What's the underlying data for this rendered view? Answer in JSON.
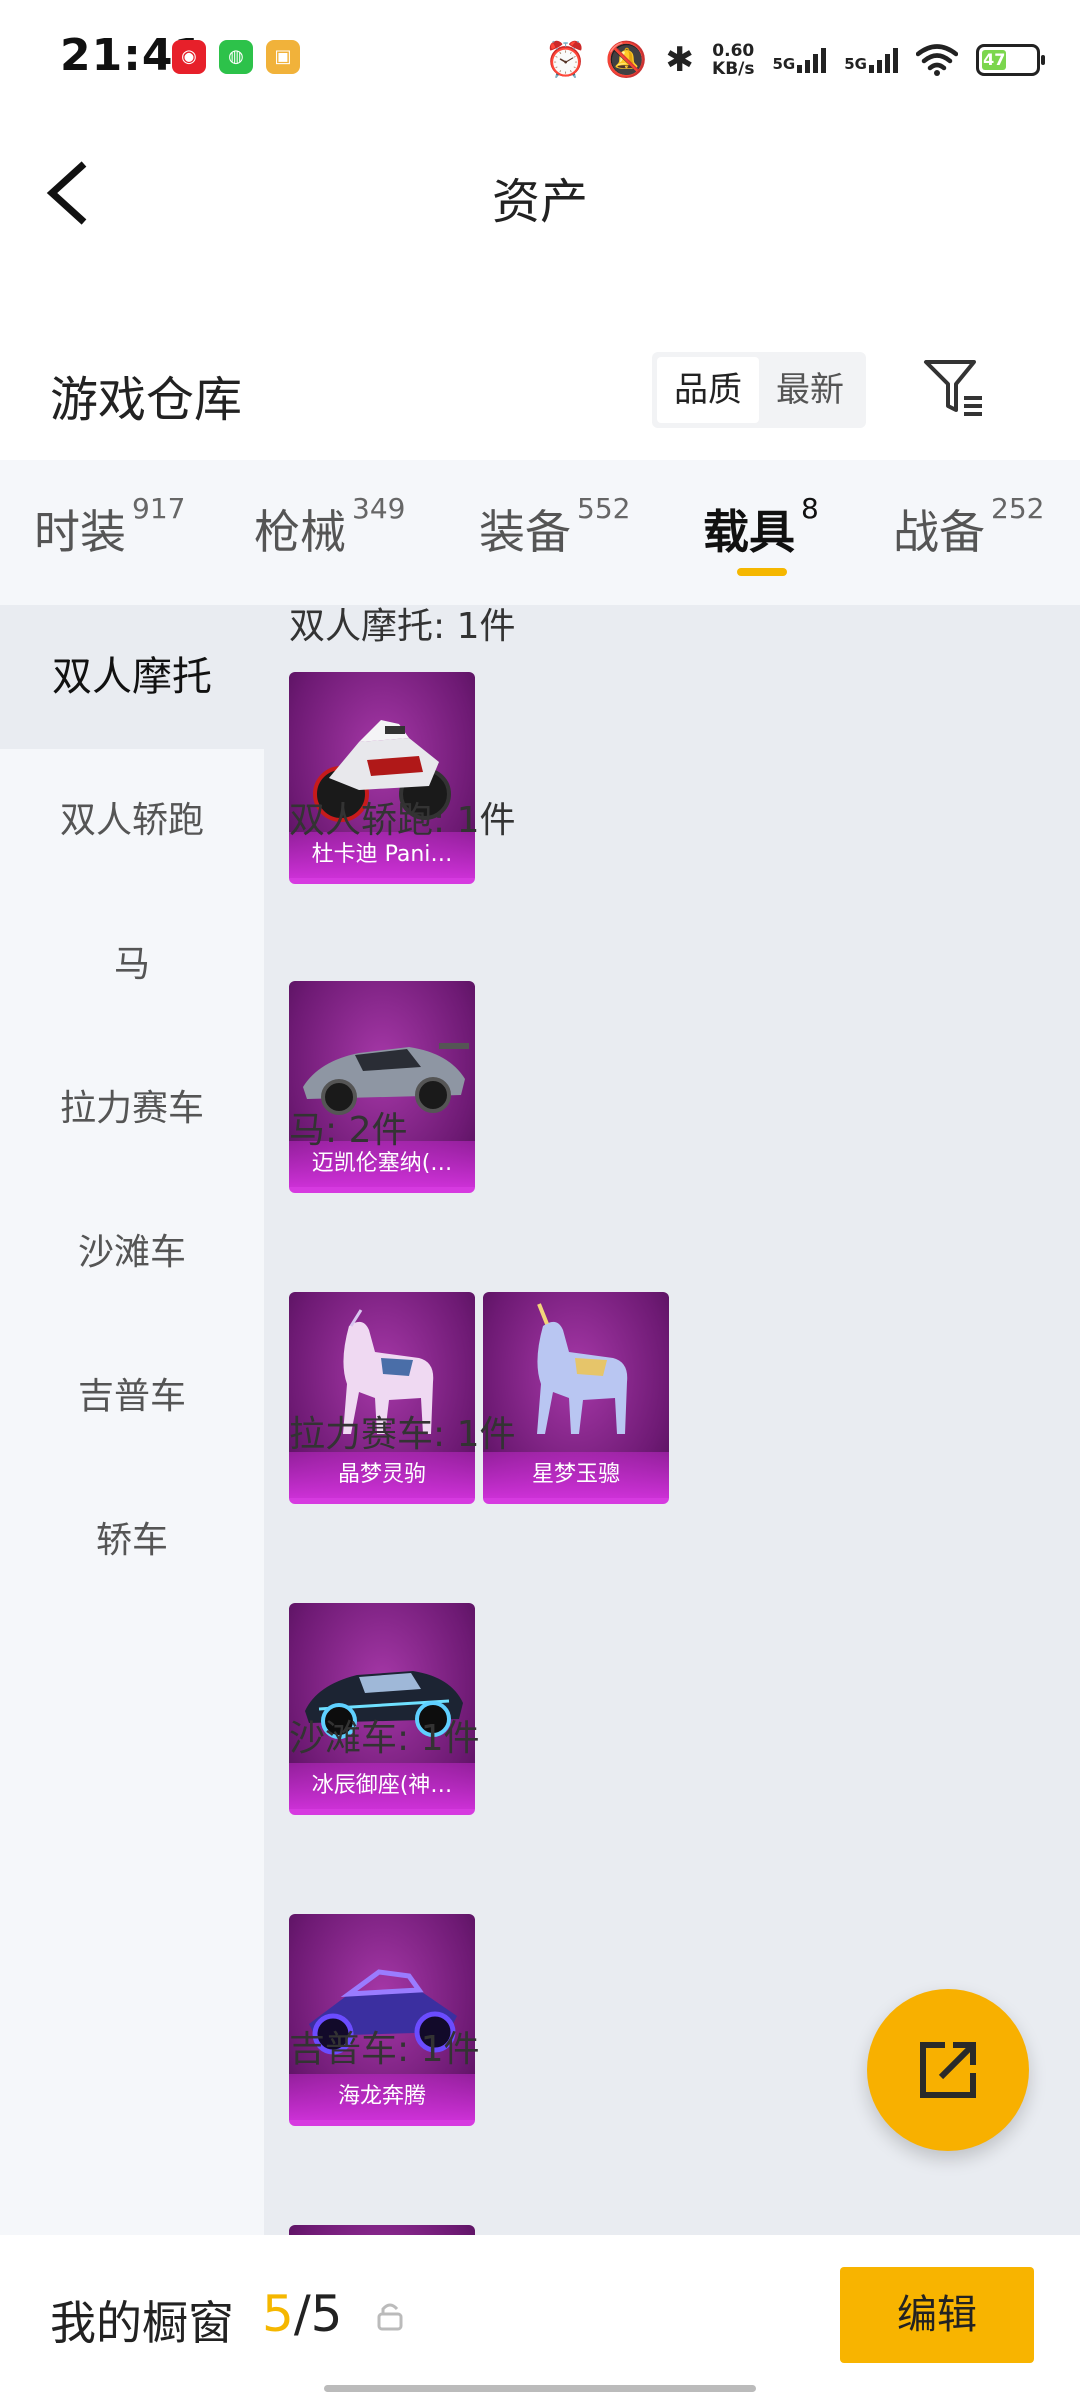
{
  "status_bar": {
    "time": "21:41",
    "speed_value": "0.60",
    "speed_unit": "KB/s",
    "network_1": "5G",
    "network_2": "5G",
    "battery": "47",
    "icons": [
      "netease-music-icon",
      "wechat-icon",
      "game-app-icon",
      "alarm-icon",
      "mute-icon",
      "bluetooth-icon",
      "signal-icon",
      "wifi-icon",
      "battery-icon"
    ]
  },
  "header": {
    "title": "资产"
  },
  "warehouse": {
    "title": "游戏仓库",
    "sort_options": [
      "品质",
      "最新"
    ],
    "active_sort": "品质"
  },
  "tabs": [
    {
      "label": "时装",
      "count": "917"
    },
    {
      "label": "枪械",
      "count": "349"
    },
    {
      "label": "装备",
      "count": "552"
    },
    {
      "label": "载具",
      "count": "8"
    },
    {
      "label": "战备",
      "count": "252"
    }
  ],
  "active_tab": "载具",
  "sidebar": {
    "items": [
      "双人摩托",
      "双人轿跑",
      "马",
      "拉力赛车",
      "沙滩车",
      "吉普车",
      "轿车"
    ],
    "active": "双人摩托"
  },
  "groups": [
    {
      "title": "双人摩托: 1件",
      "items": [
        "杜卡迪 Pani…"
      ]
    },
    {
      "title": "双人轿跑: 1件",
      "items": [
        "迈凯伦塞纳(…"
      ]
    },
    {
      "title": "马: 2件",
      "items": [
        "晶梦灵驹",
        "星梦玉骢"
      ]
    },
    {
      "title": "拉力赛车: 1件",
      "items": [
        "冰辰御座(神…"
      ]
    },
    {
      "title": "沙滩车: 1件",
      "items": [
        "海龙奔腾"
      ]
    },
    {
      "title": "吉普车: 1件",
      "items": []
    }
  ],
  "bottom_bar": {
    "label": "我的橱窗",
    "current": "5",
    "separator": "/",
    "total": "5",
    "edit_label": "编辑"
  },
  "colors": {
    "accent": "#f5b700",
    "card_purple": "#7a1f80",
    "card_border": "#d63ae0"
  }
}
